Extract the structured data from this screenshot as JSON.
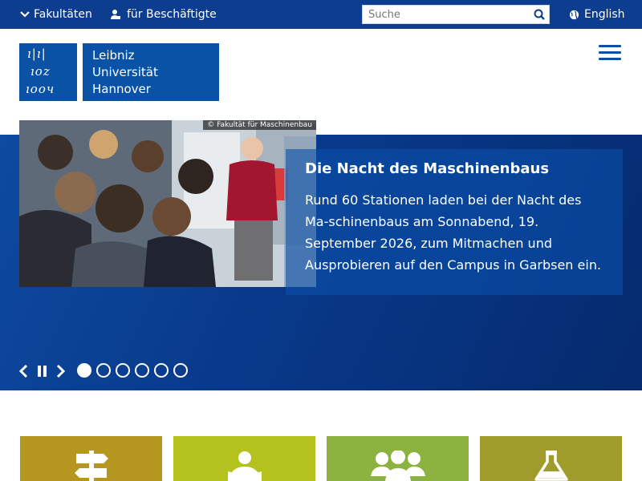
{
  "topbar": {
    "faculties_label": "Fakultäten",
    "staff_label": "für Beschäftigte",
    "search_placeholder": "Suche",
    "language_label": "English"
  },
  "logo": {
    "mark_lines": [
      "ı|ı|",
      "ıoz",
      "ıooч"
    ],
    "line1": "Leibniz",
    "line2": "Universität",
    "line3": "Hannover"
  },
  "hero": {
    "photo_credit": "© Fakultät für Maschinenbau",
    "title": "Die Nacht des Maschinenbaus",
    "text": "Rund 60 Stationen laden bei der Nacht des Ma-schinenbaus am Sonnabend, 19. September 2026, zum Mitmachen und Ausprobieren auf den Campus in Garbsen ein.",
    "slide_count": 6,
    "active_slide": 1
  },
  "colors": {
    "topbar": "#0c3d8e",
    "logo_blue": "#0a52a6",
    "tile1": "#b5961f",
    "tile2": "#b4c21d",
    "tile3": "#8cb23f",
    "tile4": "#a09c2c"
  },
  "tiles": [
    {
      "icon": "signpost-icon"
    },
    {
      "icon": "reading-person-icon"
    },
    {
      "icon": "people-group-icon"
    },
    {
      "icon": "flask-icon"
    }
  ]
}
